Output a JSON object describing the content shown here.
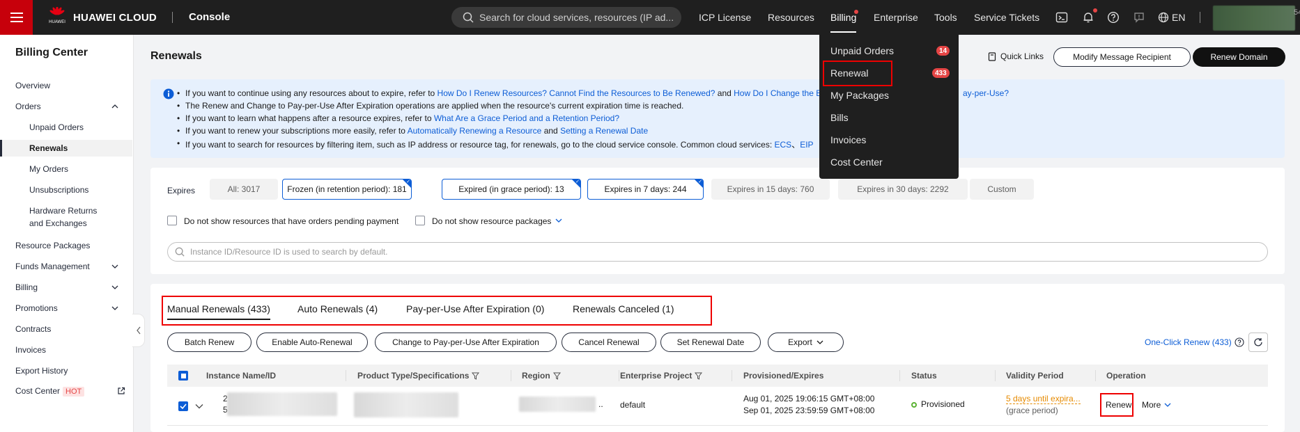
{
  "topbar": {
    "brand": "HUAWEI CLOUD",
    "brand_sub": "HUAWEI",
    "console": "Console",
    "search_placeholder": "Search for cloud services, resources (IP ad...",
    "nav": [
      "ICP License",
      "Resources",
      "Billing",
      "Enterprise",
      "Tools",
      "Service Tickets"
    ],
    "lang": "EN",
    "partial_number": "54"
  },
  "billing_menu": {
    "items": [
      "Unpaid Orders",
      "Renewal",
      "My Packages",
      "Bills",
      "Invoices",
      "Cost Center"
    ],
    "unpaid_badge": "14",
    "renewal_badge": "433"
  },
  "sidebar": {
    "title": "Billing Center",
    "overview": "Overview",
    "orders": "Orders",
    "unpaid_orders": "Unpaid Orders",
    "renewals": "Renewals",
    "my_orders": "My Orders",
    "unsubscriptions": "Unsubscriptions",
    "hw_returns_1": "Hardware Returns",
    "hw_returns_2": "and Exchanges",
    "resource_packages": "Resource Packages",
    "funds_management": "Funds Management",
    "billing": "Billing",
    "promotions": "Promotions",
    "contracts": "Contracts",
    "invoices": "Invoices",
    "export_history": "Export History",
    "cost_center": "Cost Center",
    "hot": "HOT"
  },
  "header": {
    "title": "Renewals",
    "quick_links": "Quick Links",
    "modify_recipient": "Modify Message Recipient",
    "renew_domain": "Renew Domain"
  },
  "info": {
    "l1_pre": "If you want to continue using any resources about to expire, refer to ",
    "l1_link1": "How Do I Renew Resources? Cannot Find the Resources to Be Renewed?",
    "l1_mid": " and ",
    "l1_link2": "How Do I Change the B",
    "l1_link3": "ay-per-Use?",
    "l2": "The Renew and Change to Pay-per-Use After Expiration operations are applied when the resource's current expiration time is reached.",
    "l3_pre": "If you want to learn what happens after a resource expires, refer to ",
    "l3_link": "What Are a Grace Period and a Retention Period?",
    "l4_pre": "If you want to renew your subscriptions more easily, refer to ",
    "l4_link1": "Automatically Renewing a Resource",
    "l4_mid": " and ",
    "l4_link2": "Setting a Renewal Date",
    "l5_pre": "If you want to search for resources by filtering item, such as IP address or resource tag, for renewals, go to the cloud service console. Common cloud services: ",
    "l5_link1": "ECS",
    "l5_sep": "、",
    "l5_link2": "EIP"
  },
  "filters": {
    "label": "Expires",
    "chips": [
      "All: 3017",
      "Frozen (in retention period): 181",
      "Expired (in grace period): 13",
      "Expires in 7 days: 244",
      "Expires in 15 days: 760",
      "Expires in 30 days: 2292",
      "Custom"
    ],
    "pending_payment": "Do not show resources that have orders pending payment",
    "resource_packages": "Do not show resource packages",
    "search_placeholder": "Instance ID/Resource ID is used to search by default."
  },
  "tabs": [
    "Manual Renewals (433)",
    "Auto Renewals (4)",
    "Pay-per-Use After Expiration (0)",
    "Renewals Canceled (1)"
  ],
  "actions": [
    "Batch Renew",
    "Enable Auto-Renewal",
    "Change to Pay-per-Use After Expiration",
    "Cancel Renewal",
    "Set Renewal Date",
    "Export"
  ],
  "one_click": "One-Click Renew (433)",
  "table": {
    "columns": [
      "Instance Name/ID",
      "Product Type/Specifications",
      "Region",
      "Enterprise Project",
      "Provisioned/Expires",
      "Status",
      "Validity Period",
      "Operation"
    ],
    "row": {
      "name_prefix_1": "2",
      "name_prefix_2": "5",
      "region_suffix": "..",
      "project": "default",
      "provisioned": "Aug 01, 2025 19:06:15 GMT+08:00",
      "expires": "Sep 01, 2025 23:59:59 GMT+08:00",
      "status": "Provisioned",
      "validity": "5 days until expira...",
      "validity_sub": "(grace period)",
      "renew": "Renew",
      "more": "More"
    }
  }
}
